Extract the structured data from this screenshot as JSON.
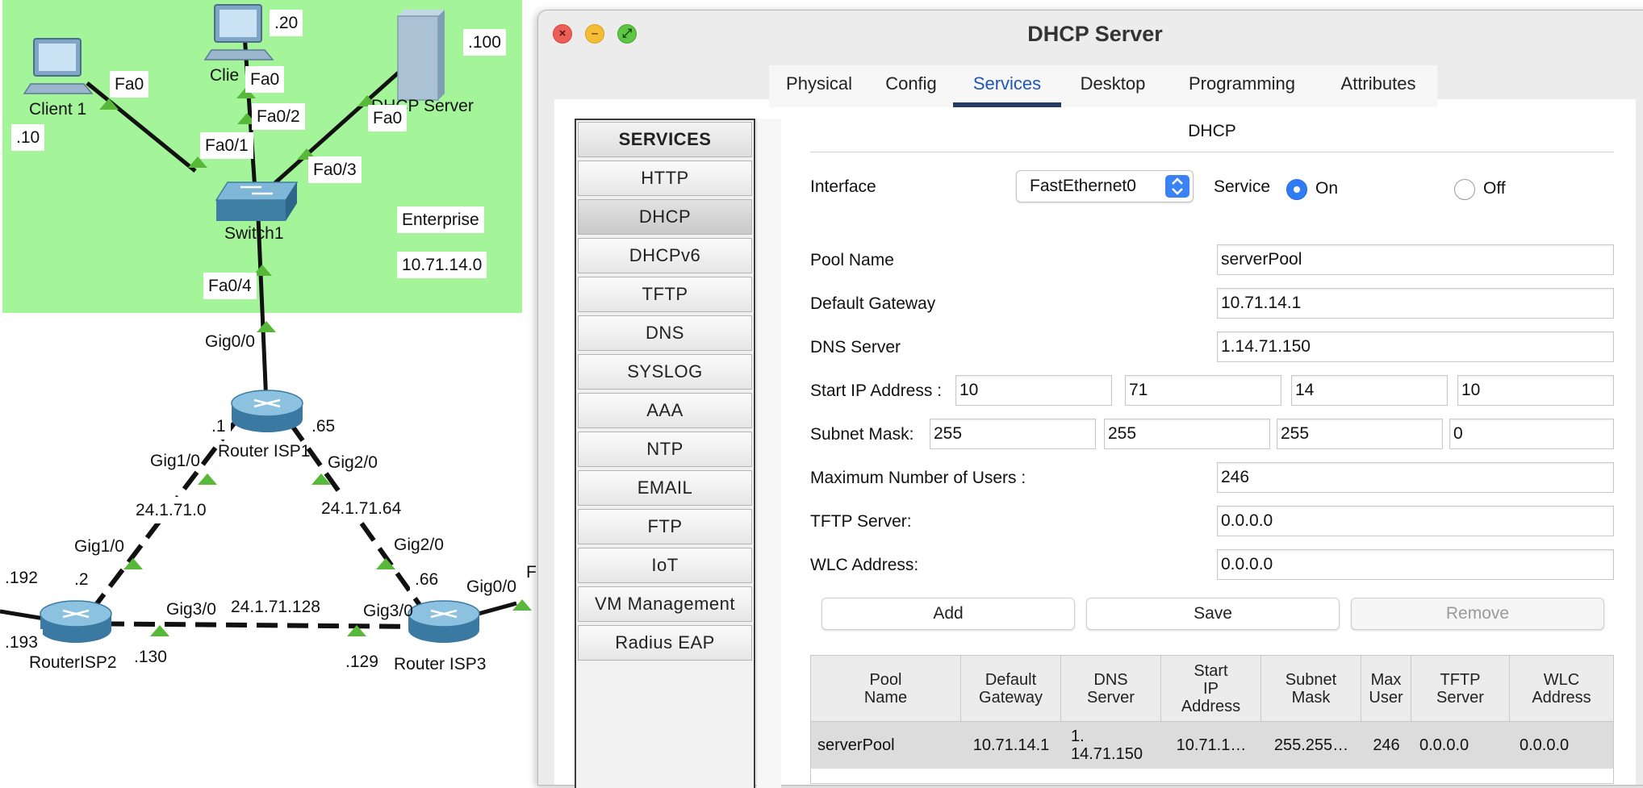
{
  "topology": {
    "area_label": "Enterprise",
    "area_network": "10.71.14.0",
    "devices": {
      "client1": "Client 1",
      "client2": "Clie",
      "server": "DHCP Server",
      "switch": "Switch1",
      "router1": "Router ISP1",
      "router2": "RouterISP2",
      "router3": "Router ISP3"
    },
    "ports": {
      "c1_fa0": "Fa0",
      "c2_fa0": "Fa0",
      "srv_fa0": "Fa0",
      "sw_fa01": "Fa0/1",
      "sw_fa02": "Fa0/2",
      "sw_fa03": "Fa0/3",
      "sw_fa04": "Fa0/4",
      "r1_gig00": "Gig0/0",
      "r1_gig10": "Gig1/0",
      "r1_gig20": "Gig2/0",
      "r2_gig10": "Gig1/0",
      "r2_gig30": "Gig3/0",
      "r3_gig20": "Gig2/0",
      "r3_gig30": "Gig3/0",
      "r3_gig00": "Gig0/0",
      "r3_f_partial": "F"
    },
    "hosts": {
      "c1": ".10",
      "c2": ".20",
      "srv": ".100",
      "r1_left": ".1",
      "r1_right": ".65",
      "r2_top": ".2",
      "r2_left_top": ".192",
      "r2_left_bottom": ".193",
      "r2_right": ".130",
      "r3_top": ".66",
      "r3_left": ".129"
    },
    "networks": {
      "n1": "24.1.71.0",
      "n2": "24.1.71.64",
      "n3": "24.1.71.128"
    }
  },
  "window": {
    "title": "DHCP Server",
    "tabs": [
      "Physical",
      "Config",
      "Services",
      "Desktop",
      "Programming",
      "Attributes"
    ],
    "active_tab": "Services"
  },
  "services": {
    "header": "SERVICES",
    "items": [
      "HTTP",
      "DHCP",
      "DHCPv6",
      "TFTP",
      "DNS",
      "SYSLOG",
      "AAA",
      "NTP",
      "EMAIL",
      "FTP",
      "IoT",
      "VM Management",
      "Radius EAP"
    ],
    "selected": "DHCP"
  },
  "dhcp": {
    "section_title": "DHCP",
    "interface_label": "Interface",
    "interface_value": "FastEthernet0",
    "service_label": "Service",
    "on_label": "On",
    "off_label": "Off",
    "service_state": "On",
    "pool_name_label": "Pool Name",
    "pool_name": "serverPool",
    "gateway_label": "Default Gateway",
    "gateway": "10.71.14.1",
    "dns_label": "DNS Server",
    "dns": "1.14.71.150",
    "start_ip_label": "Start IP Address :",
    "start_ip": [
      "10",
      "71",
      "14",
      "10"
    ],
    "mask_label": "Subnet Mask:",
    "mask": [
      "255",
      "255",
      "255",
      "0"
    ],
    "max_users_label": "Maximum Number of Users :",
    "max_users": "246",
    "tftp_label": "TFTP Server:",
    "tftp": "0.0.0.0",
    "wlc_label": "WLC Address:",
    "wlc": "0.0.0.0",
    "buttons": {
      "add": "Add",
      "save": "Save",
      "remove": "Remove"
    }
  },
  "pool_table": {
    "headers": [
      [
        "Pool",
        "Name"
      ],
      [
        "Default",
        "Gateway"
      ],
      [
        "DNS",
        "Server"
      ],
      [
        "Start",
        "IP",
        "Address"
      ],
      [
        "Subnet",
        "Mask"
      ],
      [
        "Max",
        "User"
      ],
      [
        "TFTP",
        "Server"
      ],
      [
        "WLC",
        "Address"
      ]
    ],
    "rows": [
      {
        "name": "serverPool",
        "gateway": "10.71.14.1",
        "dns_line1": "1.",
        "dns_line2": "14.71.150",
        "start_ip": "10.71.1…",
        "mask": "255.255…",
        "max_users": "246",
        "tftp": "0.0.0.0",
        "wlc": "0.0.0.0"
      }
    ]
  },
  "colors": {
    "enterprise_area": "#a4f59a",
    "link": "#111111",
    "link_up_triangle": "#57b83a",
    "active_tab_underline": "#243a67",
    "radio_on": "#2f7cf6"
  }
}
